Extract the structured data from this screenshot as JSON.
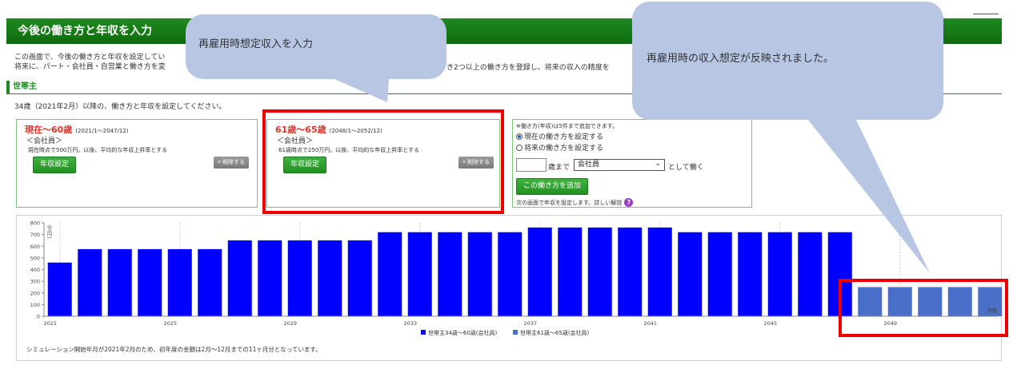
{
  "page": {
    "title": "今後の働き方と年収を入力",
    "intro_line1": "この画面で、今後の働き方と年収を設定してい",
    "intro_line2": "将来に、パート・会社員・自営業と働き方を変",
    "intro_right": "き2つ以上の働き方を登録し、将来の収入の精度を",
    "section": "世帯主",
    "description": "34歳（2021年2月）以降の、働き方と年収を設定してください。"
  },
  "cards": [
    {
      "title": "現在〜60歳",
      "range": "(2021/1〜2047/12)",
      "type": "＜会社員＞",
      "note": "現在時点で500万円。以後、平均的な年収上昇率とする",
      "button": "年収設定",
      "delete": "× 削除する"
    },
    {
      "title": "61歳〜65歳",
      "range": "(2048/1〜2052/12)",
      "type": "＜会社員＞",
      "note": "61歳時点で250万円。以後、平均的な年収上昇率とする",
      "button": "年収設定",
      "delete": "× 削除する"
    }
  ],
  "add_panel": {
    "note": "※働き方(年収)は5件まで追加できます。",
    "radio_current": "現在の働き方を設定する",
    "radio_future": "将来の働き方を設定する",
    "age_value": "",
    "age_suffix": "歳まで",
    "job_selected": "会社員",
    "work_suffix": "として働く",
    "add_button": "この働き方を追加",
    "next_note": "次の画面で年収を設定します。詳しい解説"
  },
  "bubbles": {
    "left": "再雇用時想定収入を入力",
    "right": "再雇用時の収入想定が反映されました。"
  },
  "colors": {
    "header_green": "#1f8a1f",
    "series1": "#0000ff",
    "series2": "#4a6fc9",
    "highlight": "#ee0000",
    "bubble": "#b7c7e3"
  },
  "chart_data": {
    "type": "bar",
    "categories": [
      "2021",
      "2022",
      "2023",
      "2024",
      "2025",
      "2026",
      "2027",
      "2028",
      "2029",
      "2030",
      "2031",
      "2032",
      "2033",
      "2034",
      "2035",
      "2036",
      "2037",
      "2038",
      "2039",
      "2040",
      "2041",
      "2042",
      "2043",
      "2044",
      "2045",
      "2046",
      "2047",
      "2048",
      "2049",
      "2050",
      "2051",
      "2052"
    ],
    "x_tick_labels": [
      "2021",
      "2025",
      "2029",
      "2033",
      "2037",
      "2041",
      "2045",
      "2049"
    ],
    "x_unit": "西暦",
    "ylabel": "(万円)",
    "ylim": [
      0,
      800
    ],
    "y_ticks": [
      0,
      100,
      200,
      300,
      400,
      500,
      600,
      700,
      800
    ],
    "grid": "vertical dashed",
    "legend_position": "bottom",
    "series": [
      {
        "name": "世帯主34歳〜60歳(会社員)",
        "color": "#0000ff",
        "values": [
          460,
          575,
          575,
          575,
          575,
          575,
          650,
          650,
          650,
          650,
          650,
          720,
          720,
          720,
          720,
          720,
          760,
          760,
          760,
          760,
          760,
          720,
          720,
          720,
          720,
          720,
          720,
          null,
          null,
          null,
          null,
          null
        ]
      },
      {
        "name": "世帯主61歳〜65歳(会社員)",
        "color": "#4a6fc9",
        "values": [
          null,
          null,
          null,
          null,
          null,
          null,
          null,
          null,
          null,
          null,
          null,
          null,
          null,
          null,
          null,
          null,
          null,
          null,
          null,
          null,
          null,
          null,
          null,
          null,
          null,
          null,
          null,
          250,
          250,
          250,
          250,
          250
        ]
      }
    ],
    "footnote": "シミュレーション開始年月が2021年2月のため、初年度の金額は2月〜12月までの11ヶ月分となっています。"
  }
}
